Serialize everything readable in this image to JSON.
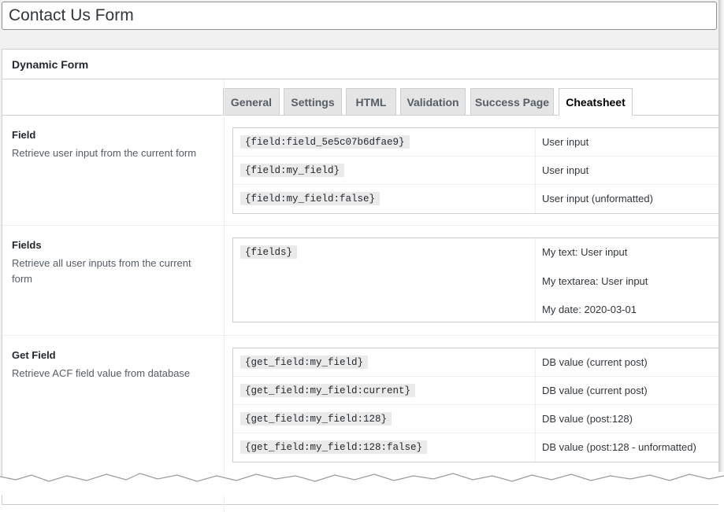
{
  "post": {
    "title": "Contact Us Form"
  },
  "metabox": {
    "title": "Dynamic Form"
  },
  "tabs": [
    {
      "label": "General"
    },
    {
      "label": "Settings"
    },
    {
      "label": "HTML"
    },
    {
      "label": "Validation"
    },
    {
      "label": "Success Page"
    },
    {
      "label": "Cheatsheet"
    }
  ],
  "active_tab": "Cheatsheet",
  "sections": {
    "field": {
      "label": "Field",
      "description": "Retrieve user input from the current form",
      "rows": [
        {
          "code": "{field:field_5e5c07b6dfae9}",
          "value": "User input"
        },
        {
          "code": "{field:my_field}",
          "value": "User input"
        },
        {
          "code": "{field:my_field:false}",
          "value": "User input (unformatted)"
        }
      ]
    },
    "fields": {
      "label": "Fields",
      "description": "Retrieve all user inputs from the current form",
      "code": "{fields}",
      "values": [
        "My text: User input",
        "My textarea: User input",
        "My date: 2020-03-01"
      ]
    },
    "get_field": {
      "label": "Get Field",
      "description": "Retrieve ACF field value from database",
      "rows": [
        {
          "code": "{get_field:my_field}",
          "value": "DB value (current post)"
        },
        {
          "code": "{get_field:my_field:current}",
          "value": "DB value (current post)"
        },
        {
          "code": "{get_field:my_field:128}",
          "value": "DB value (post:128)"
        },
        {
          "code": "{get_field:my_field:128:false}",
          "value": "DB value (post:128 - unformatted)"
        }
      ]
    }
  }
}
